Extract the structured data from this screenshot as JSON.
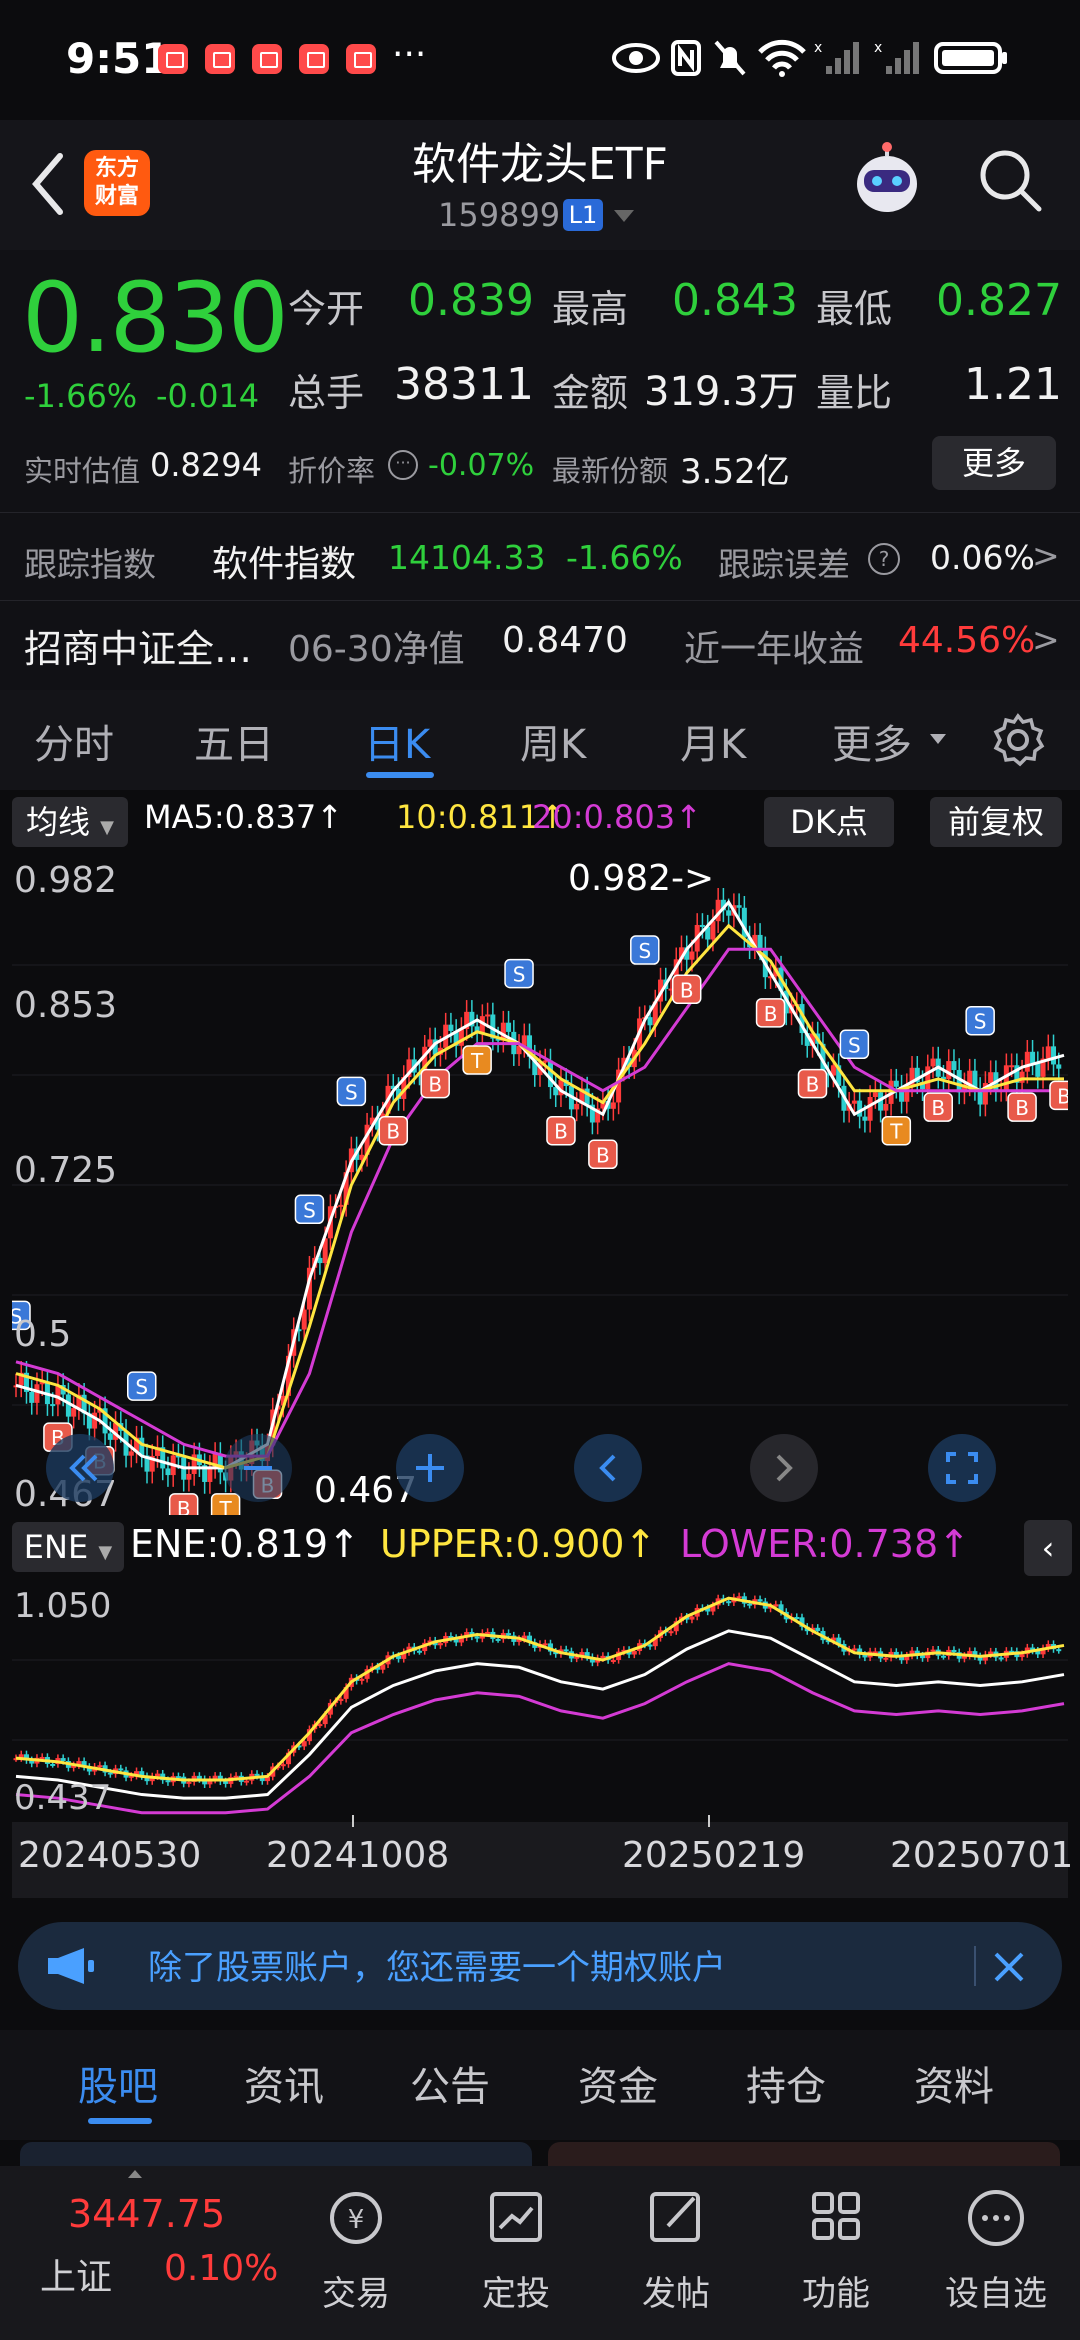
{
  "status_bar": {
    "time": "9:51",
    "more": "···"
  },
  "header": {
    "title": "软件龙头ETF",
    "code": "159899",
    "level": "L1",
    "logo_line1": "东方",
    "logo_line2": "财富"
  },
  "quote": {
    "price": "0.830",
    "change_pct": "-1.66%",
    "change_amt": "-0.014",
    "open_label": "今开",
    "open": "0.839",
    "high_label": "最高",
    "high": "0.843",
    "low_label": "最低",
    "low": "0.827",
    "volume_label": "总手",
    "volume": "38311",
    "amount_label": "金额",
    "amount": "319.3万",
    "ratio_label": "量比",
    "ratio": "1.21",
    "iopv_label": "实时估值",
    "iopv": "0.8294",
    "premium_label": "折价率",
    "premium": "-0.07%",
    "shares_label": "最新份额",
    "shares": "3.52亿",
    "more_button": "更多"
  },
  "tracking": {
    "label": "跟踪指数",
    "index_name": "软件指数",
    "index_value": "14104.33",
    "index_change": "-1.66%",
    "error_label": "跟踪误差",
    "error_value": "0.06%",
    "arrow": ">"
  },
  "fund_info": {
    "manager": "招商中证全…",
    "nav_label": "06-30净值",
    "nav": "0.8470",
    "return_label": "近一年收益",
    "return_value": "44.56%",
    "arrow": ">"
  },
  "chart_tabs": [
    "分时",
    "五日",
    "日K",
    "周K",
    "月K",
    "更多"
  ],
  "active_chart_tab": "日K",
  "indicators": {
    "ma_select": "均线",
    "ma5": "MA5:0.837↑",
    "ma10": "10:0.811↑",
    "ma20": "20:0.803↑",
    "dk_button": "DK点",
    "adjust_button": "前复权",
    "ene_select": "ENE",
    "ene": "ENE:0.819↑",
    "upper": "UPPER:0.900↑",
    "lower": "LOWER:0.738↑"
  },
  "colors": {
    "up": "#ff3b3b",
    "down": "#2fd03c",
    "ma5": "#ffffff",
    "ma10": "#ffe640",
    "ma20": "#d43bd4",
    "accent": "#3b8cf0"
  },
  "chart_data": [
    {
      "type": "line",
      "title": "",
      "y_ticks": [
        "0.982",
        "0.853",
        "0.725",
        "0.5",
        "0.467"
      ],
      "max_label": "0.982->",
      "min_label": "0.467",
      "ylim": [
        0.44,
        1.0
      ],
      "series": [
        {
          "name": "MA5",
          "values": [
            0.55,
            0.54,
            0.52,
            0.49,
            0.48,
            0.48,
            0.5,
            0.64,
            0.74,
            0.8,
            0.84,
            0.86,
            0.84,
            0.8,
            0.78,
            0.86,
            0.92,
            0.96,
            0.9,
            0.84,
            0.78,
            0.8,
            0.82,
            0.8,
            0.82,
            0.83
          ]
        },
        {
          "name": "10",
          "values": [
            0.56,
            0.55,
            0.53,
            0.5,
            0.49,
            0.48,
            0.49,
            0.6,
            0.72,
            0.79,
            0.83,
            0.85,
            0.84,
            0.81,
            0.79,
            0.84,
            0.9,
            0.94,
            0.91,
            0.85,
            0.8,
            0.8,
            0.81,
            0.8,
            0.81,
            0.81
          ]
        },
        {
          "name": "20",
          "values": [
            0.57,
            0.56,
            0.54,
            0.52,
            0.5,
            0.49,
            0.49,
            0.56,
            0.68,
            0.76,
            0.81,
            0.84,
            0.84,
            0.82,
            0.8,
            0.82,
            0.87,
            0.92,
            0.92,
            0.87,
            0.82,
            0.8,
            0.8,
            0.8,
            0.8,
            0.8
          ]
        }
      ]
    },
    {
      "type": "line",
      "y_ticks": [
        "1.050",
        "0.437"
      ],
      "ylim": [
        0.42,
        1.08
      ],
      "series": [
        {
          "name": "UPPER",
          "values": [
            0.59,
            0.58,
            0.56,
            0.54,
            0.53,
            0.53,
            0.54,
            0.66,
            0.8,
            0.87,
            0.91,
            0.93,
            0.92,
            0.88,
            0.86,
            0.9,
            0.98,
            1.03,
            1.01,
            0.94,
            0.88,
            0.87,
            0.88,
            0.87,
            0.88,
            0.9
          ]
        },
        {
          "name": "ENE",
          "values": [
            0.54,
            0.53,
            0.51,
            0.49,
            0.48,
            0.48,
            0.49,
            0.6,
            0.73,
            0.79,
            0.83,
            0.85,
            0.84,
            0.8,
            0.78,
            0.82,
            0.89,
            0.94,
            0.92,
            0.86,
            0.8,
            0.79,
            0.8,
            0.79,
            0.8,
            0.82
          ]
        },
        {
          "name": "LOWER",
          "values": [
            0.49,
            0.48,
            0.46,
            0.44,
            0.44,
            0.44,
            0.45,
            0.54,
            0.66,
            0.71,
            0.75,
            0.77,
            0.76,
            0.72,
            0.7,
            0.74,
            0.8,
            0.85,
            0.83,
            0.77,
            0.72,
            0.71,
            0.72,
            0.71,
            0.72,
            0.74
          ]
        }
      ],
      "x_ticks": [
        "20240530",
        "20241008",
        "20250219",
        "20250701"
      ]
    }
  ],
  "banner": {
    "text": "除了股票账户，您还需要一个期权账户"
  },
  "bottom_tabs": [
    "股吧",
    "资讯",
    "公告",
    "资金",
    "持仓",
    "资料"
  ],
  "active_bottom_tab": "股吧",
  "bottom_nav": {
    "index_value": "3447.75",
    "index_name": "上证",
    "index_change": "0.10%",
    "items": [
      "交易",
      "定投",
      "发帖",
      "功能",
      "设自选"
    ]
  }
}
